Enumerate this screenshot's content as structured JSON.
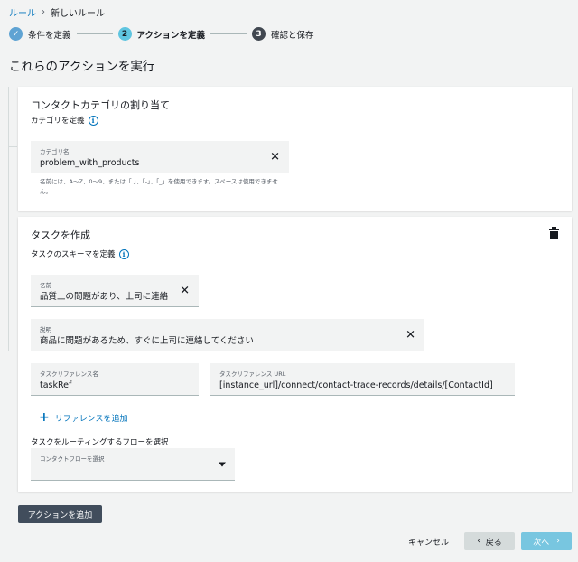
{
  "breadcrumb": {
    "root": "ルール",
    "separator": "›",
    "current": "新しいルール"
  },
  "steps": [
    {
      "number": "✓",
      "label": "条件を定義",
      "state": "done"
    },
    {
      "number": "2",
      "label": "アクションを定義",
      "state": "active"
    },
    {
      "number": "3",
      "label": "確認と保存",
      "state": "todo"
    }
  ],
  "page_title": "これらのアクションを実行",
  "category_panel": {
    "title": "コンタクトカテゴリの割り当て",
    "label": "カテゴリを定義",
    "field_label": "カテゴリ名",
    "field_value": "problem_with_products",
    "hint": "名前には、A～Z、0～9、または「.」、「-」、「_」を使用できます。スペースは使用できません。"
  },
  "task_panel": {
    "title": "タスクを作成",
    "label": "タスクのスキーマを定義",
    "name_label": "名前",
    "name_value": "品質上の問題があり、上司に連絡",
    "desc_label": "説明",
    "desc_value": "商品に問題があるため、すぐに上司に連絡してください",
    "ref_name_label": "タスクリファレンス名",
    "ref_name_value": "taskRef",
    "ref_url_label": "タスクリファレンス URL",
    "ref_url_value": "[instance_url]/connect/contact-trace-records/details/[ContactId]",
    "add_reference": "リファレンスを追加",
    "flow_label": "タスクをルーティングするフローを選択",
    "flow_select_label": "コンタクトフローを選択",
    "flow_select_value": ""
  },
  "buttons": {
    "add_action": "アクションを追加",
    "cancel": "キャンセル",
    "back": "戻る",
    "next": "次へ"
  },
  "colors": {
    "link": "#0073bb",
    "primary_disabled": "#78c6e0",
    "dark_button": "#414d5c"
  }
}
